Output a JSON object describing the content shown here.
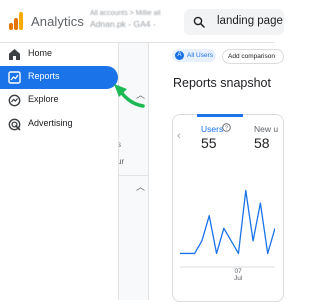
{
  "header": {
    "app_title": "Analytics",
    "account_line1": "All accounts > Millie all",
    "account_line2": "Adnan.pk - GA4 -",
    "search_value": "landing page"
  },
  "sidebar": {
    "items": [
      {
        "label": "Home",
        "icon": "home-icon",
        "active": false
      },
      {
        "label": "Reports",
        "icon": "reports-icon",
        "active": true
      },
      {
        "label": "Explore",
        "icon": "explore-icon",
        "active": false
      },
      {
        "label": "Advertising",
        "icon": "advertising-icon",
        "active": false
      }
    ]
  },
  "subpanel": {
    "frag1": "s",
    "frag2": "ur"
  },
  "filters": {
    "segment_badge": "A",
    "segment_label": "All Users",
    "add_comparison": "Add comparison"
  },
  "main": {
    "title": "Reports snapshot",
    "tabs": [
      {
        "label": "Users",
        "value": "55",
        "selected": true
      },
      {
        "label": "New u",
        "value": "58",
        "selected": false
      }
    ],
    "x_tick_day": "07",
    "x_tick_month": "Jul"
  },
  "chart_data": {
    "type": "line",
    "series": [
      {
        "values": [
          1,
          1,
          1,
          2,
          4,
          1,
          3,
          2,
          1,
          6,
          2,
          5,
          1,
          3
        ]
      }
    ],
    "ylim": [
      0,
      7
    ]
  },
  "colors": {
    "accent": "#1a73e8",
    "annotation_arrow": "#1db954"
  }
}
